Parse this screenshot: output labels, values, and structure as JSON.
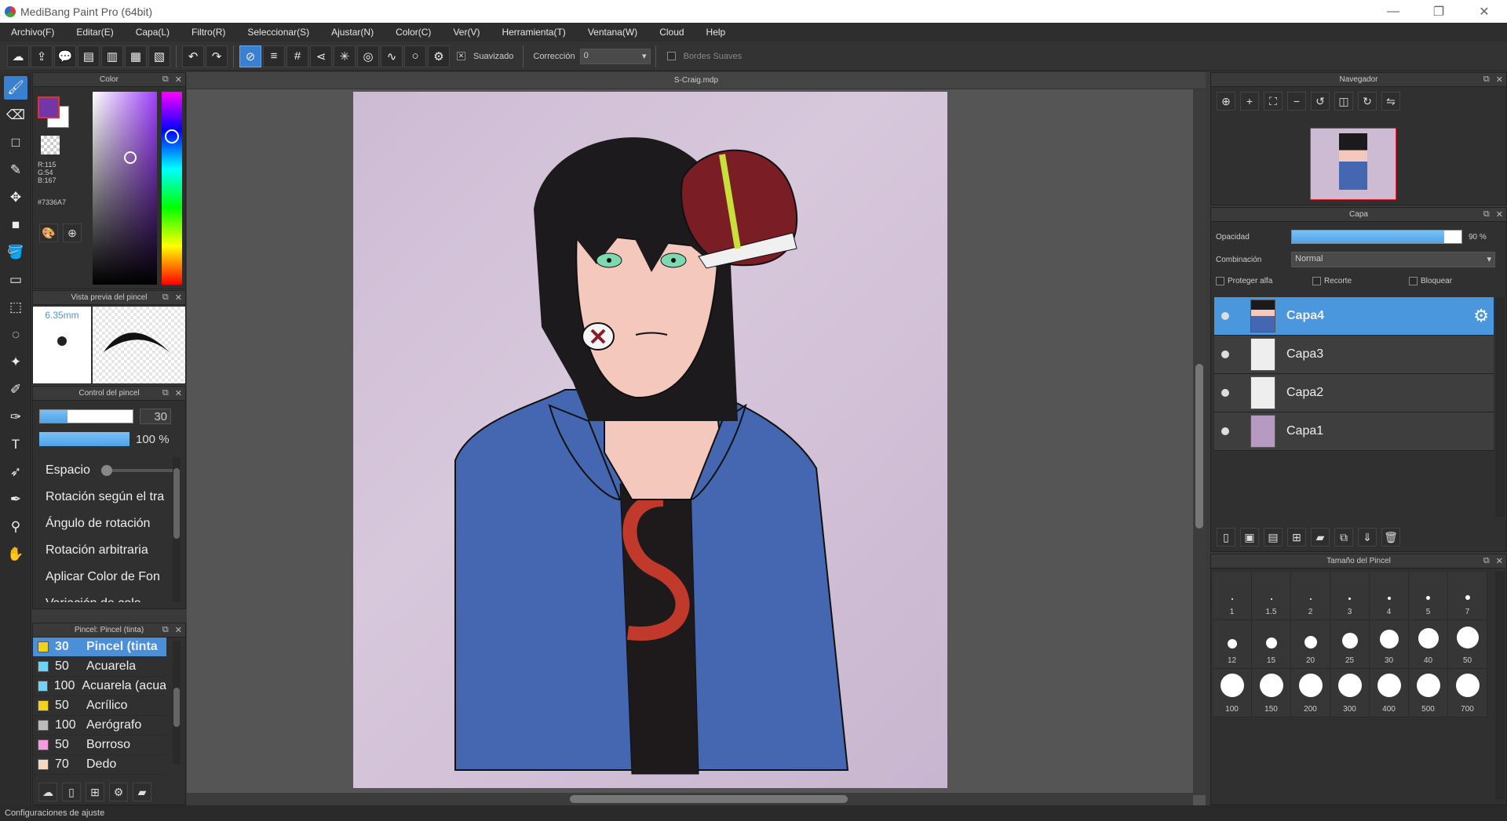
{
  "window": {
    "title": "MediBang Paint Pro (64bit)",
    "minimize": "—",
    "restore": "❐",
    "close": "✕"
  },
  "menu": [
    "Archivo(F)",
    "Editar(E)",
    "Capa(L)",
    "Filtro(R)",
    "Seleccionar(S)",
    "Ajustar(N)",
    "Color(C)",
    "Ver(V)",
    "Herramienta(T)",
    "Ventana(W)",
    "Cloud",
    "Help"
  ],
  "toolbar": {
    "smoothing_label": "Suavizado",
    "correction_label": "Corrección",
    "correction_value": "0",
    "soft_edges_label": "Bordes Suaves"
  },
  "document": {
    "name": "S-Craig.mdp"
  },
  "color_panel": {
    "title": "Color",
    "r": "R:115",
    "g": "G:54",
    "b": "B:167",
    "hex": "#7336A7",
    "fg_color": "#7336A7"
  },
  "brush_preview": {
    "title": "Vista previa del pincel",
    "size": "6.35mm"
  },
  "brush_control": {
    "title": "Control del pincel",
    "size_value": "30",
    "opacity_value": "100 %",
    "size_fraction": 0.3,
    "opacity_fraction": 1.0,
    "options": [
      "Espacio",
      "Rotación según el tra",
      "Ángulo de rotación",
      "Rotación arbitraria",
      "Aplicar Color de Fon",
      "Variación de colo"
    ]
  },
  "brush_list": {
    "title": "Pincel: Pincel (tinta)",
    "items": [
      {
        "size": "30",
        "name": "Pincel (tinta",
        "color": "#f2d21b"
      },
      {
        "size": "50",
        "name": "Acuarela",
        "color": "#6fd3f5"
      },
      {
        "size": "100",
        "name": "Acuarela (acua",
        "color": "#6fd3f5"
      },
      {
        "size": "50",
        "name": "Acrílico",
        "color": "#f2d21b"
      },
      {
        "size": "100",
        "name": "Aerógrafo",
        "color": "#bbbbbb"
      },
      {
        "size": "50",
        "name": "Borroso",
        "color": "#f59be0"
      },
      {
        "size": "70",
        "name": "Dedo",
        "color": "#f5d8bf"
      }
    ]
  },
  "navigator": {
    "title": "Navegador"
  },
  "layer_panel": {
    "title": "Capa",
    "opacity_label": "Opacidad",
    "opacity_value": "90 %",
    "opacity_fraction": 0.9,
    "blend_label": "Combinación",
    "blend_value": "Normal",
    "protect_alpha": "Proteger alfa",
    "clipping": "Recorte",
    "lock": "Bloquear",
    "layers": [
      "Capa4",
      "Capa3",
      "Capa2",
      "Capa1"
    ]
  },
  "brush_size_panel": {
    "title": "Tamaño del Pincel",
    "sizes": [
      "1",
      "1.5",
      "2",
      "3",
      "4",
      "5",
      "7",
      "12",
      "15",
      "20",
      "25",
      "30",
      "40",
      "50",
      "100",
      "150",
      "200",
      "300",
      "400",
      "500",
      "700"
    ]
  },
  "status": {
    "text": "Configuraciones de ajuste"
  }
}
